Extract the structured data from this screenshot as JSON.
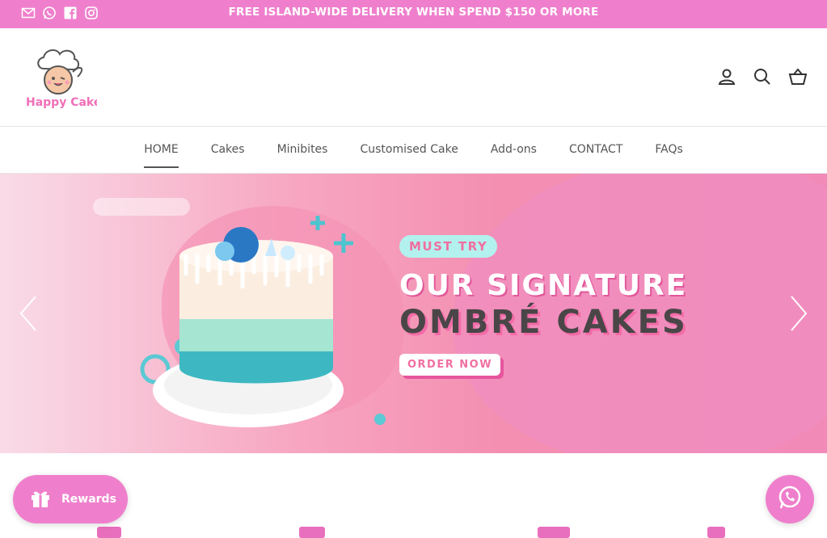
{
  "announcement": {
    "text": "FREE ISLAND-WIDE DELIVERY WHEN SPEND $150 OR MORE",
    "social_icons": [
      "mail-icon",
      "whatsapp-icon",
      "facebook-icon",
      "instagram-icon"
    ]
  },
  "header": {
    "logo_text": "Happy Cake",
    "icons": [
      "account-icon",
      "search-icon",
      "basket-icon"
    ]
  },
  "nav": {
    "items": [
      "HOME",
      "Cakes",
      "Minibites",
      "Customised Cake",
      "Add-ons",
      "CONTACT",
      "FAQs"
    ],
    "active": "HOME"
  },
  "hero": {
    "tag": "MUST TRY",
    "line1": "OUR SIGNATURE",
    "line2": "OMBRÉ CAKES",
    "cta": "ORDER NOW"
  },
  "rewards": {
    "label": "Rewards"
  },
  "colors": {
    "brand_pink": "#ef7fcc",
    "accent_teal": "#b3f1ee",
    "dark_text": "#4a4648"
  }
}
